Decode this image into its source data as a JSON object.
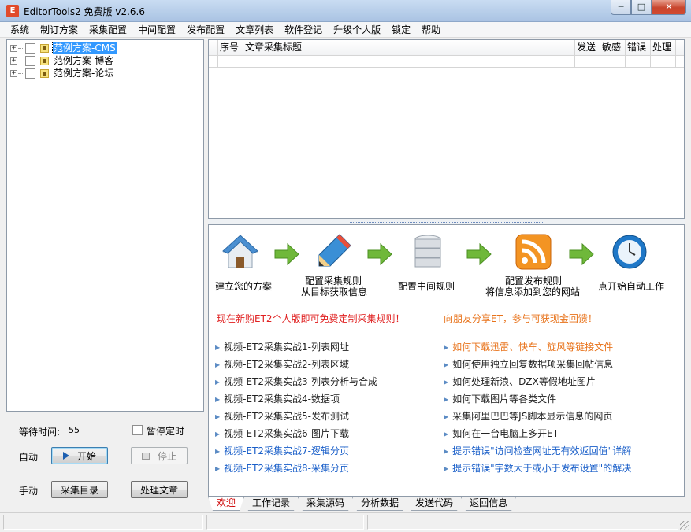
{
  "window": {
    "title": "EditorTools2 免费版 v2.6.6",
    "icon": "app-icon",
    "min": "─",
    "max": "□",
    "close": "✕"
  },
  "menu": [
    "系统",
    "制订方案",
    "采集配置",
    "中间配置",
    "发布配置",
    "文章列表",
    "软件登记",
    "升级个人版",
    "锁定",
    "帮助"
  ],
  "tree": {
    "items": [
      {
        "label": "范例方案-CMS",
        "selected": true
      },
      {
        "label": "范例方案-博客",
        "selected": false
      },
      {
        "label": "范例方案-论坛",
        "selected": false
      }
    ]
  },
  "controls": {
    "wait_label": "等待时间:",
    "wait_value": "55",
    "pause_label": "暂停定时",
    "auto_label": "自动",
    "start_button": "开始",
    "stop_button": "停止",
    "manual_label": "手动",
    "collect_list_button": "采集目录",
    "process_article_button": "处理文章"
  },
  "grid": {
    "columns": [
      "序号",
      "文章采集标题",
      "发送",
      "敏感",
      "错误",
      "处理"
    ]
  },
  "welcome": {
    "steps": [
      {
        "icon": "house-icon",
        "label1": "建立您的方案",
        "label2": ""
      },
      {
        "icon": "pencil-icon",
        "label1": "配置采集规则",
        "label2": "从目标获取信息"
      },
      {
        "icon": "database-icon",
        "label1": "配置中间规则",
        "label2": ""
      },
      {
        "icon": "rss-icon",
        "label1": "配置发布规则",
        "label2": "将信息添加到您的网站"
      },
      {
        "icon": "clock-icon",
        "label1": "点开始自动工作",
        "label2": ""
      }
    ],
    "promo_left": "现在新购ET2个人版即可免费定制采集规则！",
    "promo_right": "向朋友分享ET，参与可获现金回馈！",
    "links_left": [
      "视频-ET2采集实战1-列表网址",
      "视频-ET2采集实战2-列表区域",
      "视频-ET2采集实战3-列表分析与合成",
      "视频-ET2采集实战4-数据项",
      "视频-ET2采集实战5-发布测试",
      "视频-ET2采集实战6-图片下载",
      "视频-ET2采集实战7-逻辑分页",
      "视频-ET2采集实战8-采集分页"
    ],
    "links_right": [
      "如何下载迅雷、快车、旋风等链接文件",
      "如何使用独立回复数据项采集回帖信息",
      "如何处理新浪、DZX等假地址图片",
      "如何下载图片等各类文件",
      "采集阿里巴巴等JS脚本显示信息的网页",
      "如何在一台电脑上多开ET",
      "提示错误\"访问检查网址无有效返回值\"详解",
      "提示错误\"字数大于或小于发布设置\"的解决"
    ],
    "colors": {
      "promo_left": "#e02020",
      "promo_right": "#e8731b",
      "link_orange": "#e8731b",
      "link_blue": "#1a5fc9",
      "link_default": "#222222"
    }
  },
  "tabs": [
    "欢迎",
    "工作记录",
    "采集源码",
    "分析数据",
    "发送代码",
    "返回信息"
  ]
}
